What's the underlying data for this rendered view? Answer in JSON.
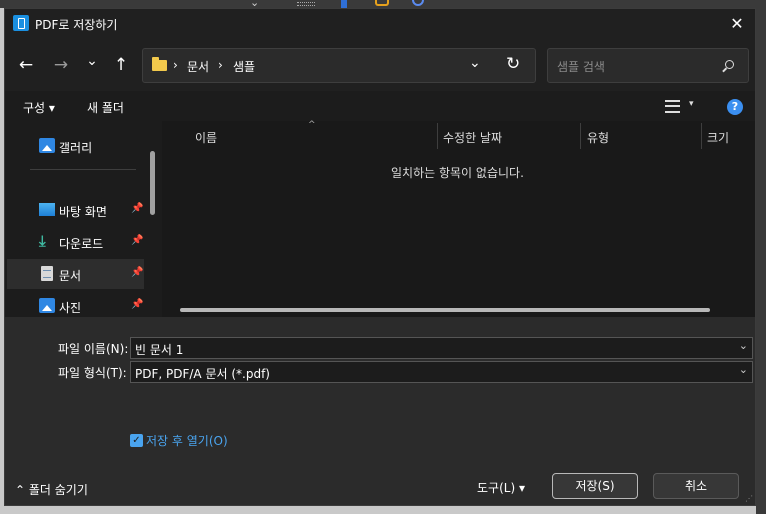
{
  "window": {
    "title": "PDF로 저장하기",
    "close": "✕"
  },
  "nav": {
    "back": "←",
    "forward": "→",
    "recent": "⌄",
    "up": "↑"
  },
  "address": {
    "sep": "›",
    "crumbs": [
      "문서",
      "샘플"
    ],
    "dropdown": "⌄",
    "refresh": "↻"
  },
  "search": {
    "placeholder": "샘플 검색"
  },
  "commands": {
    "organize": "구성 ▾",
    "new_folder": "새 폴더",
    "view_drop": "▾",
    "help": "?"
  },
  "sidebar": {
    "items": [
      {
        "label": "갤러리",
        "pinned": false
      },
      {
        "label": "바탕 화면",
        "pinned": true
      },
      {
        "label": "다운로드",
        "pinned": true
      },
      {
        "label": "문서",
        "pinned": true,
        "selected": true
      },
      {
        "label": "사진",
        "pinned": true
      }
    ],
    "pin": "📌"
  },
  "content": {
    "columns": [
      "이름",
      "수정한 날짜",
      "유형",
      "크기"
    ],
    "sort_caret": "^",
    "empty_message": "일치하는 항목이 없습니다."
  },
  "form": {
    "filename_label": "파일 이름(N):",
    "filename_value": "빈 문서 1",
    "filetype_label": "파일 형식(T):",
    "filetype_value": "PDF, PDF/A 문서 (*.pdf)",
    "field_drop": "⌄",
    "open_after_label": "저장 후 열기(O)",
    "open_after_checked": true
  },
  "footer": {
    "hide_folders": "⌃  폴더 숨기기",
    "tools": "도구(L)   ▾",
    "save": "저장(S)",
    "cancel": "취소"
  },
  "colors": {
    "accent": "#4aa4ef",
    "dialog_bg": "#202020"
  }
}
